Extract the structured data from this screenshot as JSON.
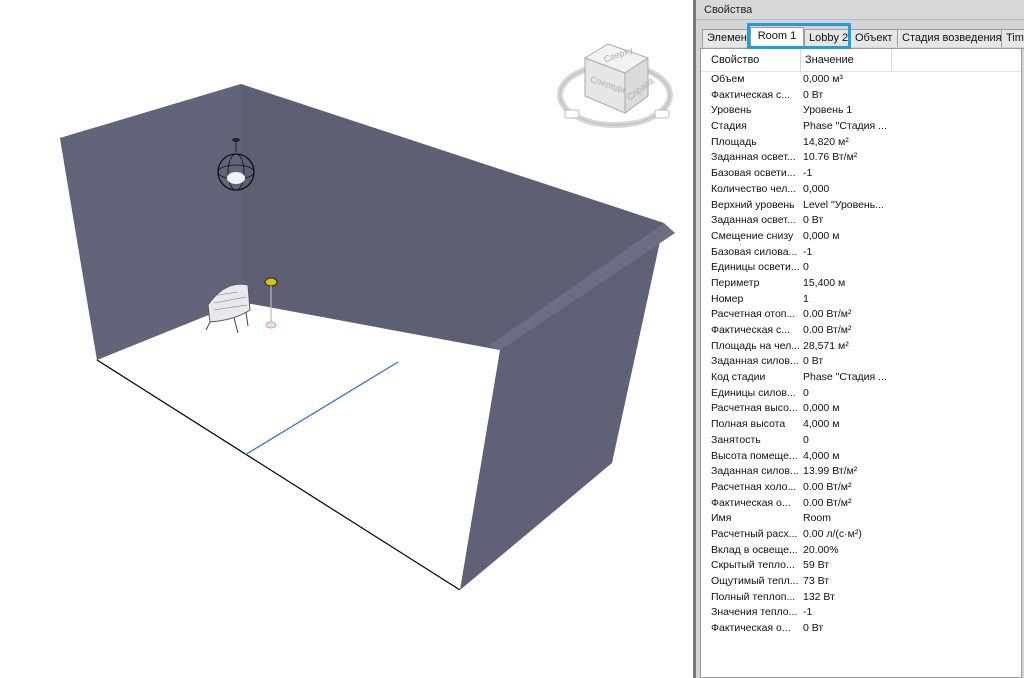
{
  "panel": {
    "title": "Свойства",
    "tabs": [
      {
        "label": "Элемент"
      },
      {
        "label": "Room 1"
      },
      {
        "label": "Lobby 2"
      },
      {
        "label": "Объект"
      },
      {
        "label": "Стадия возведения"
      },
      {
        "label": "Time"
      }
    ],
    "active_tab": "Room 1",
    "columns": {
      "property": "Свойство",
      "value": "Значение"
    },
    "rows": [
      {
        "prop": "Объем",
        "val": "0,000 м³"
      },
      {
        "prop": "Фактическая с...",
        "val": "0 Вт"
      },
      {
        "prop": "Уровень",
        "val": "Уровень 1"
      },
      {
        "prop": "Стадия",
        "val": "Phase \"Стадия ..."
      },
      {
        "prop": "Площадь",
        "val": "14,820 м²"
      },
      {
        "prop": "Заданная освет...",
        "val": "10.76 Вт/м²"
      },
      {
        "prop": "Базовая освети...",
        "val": "-1"
      },
      {
        "prop": "Количество чел...",
        "val": "0,000"
      },
      {
        "prop": "Верхний уровень",
        "val": "Level \"Уровень..."
      },
      {
        "prop": "Заданная освет...",
        "val": "0 Вт"
      },
      {
        "prop": "Смещение снизу",
        "val": "0,000 м"
      },
      {
        "prop": "Базовая силова...",
        "val": "-1"
      },
      {
        "prop": "Единицы освети...",
        "val": "0"
      },
      {
        "prop": "Периметр",
        "val": "15,400 м"
      },
      {
        "prop": "Номер",
        "val": "1"
      },
      {
        "prop": "Расчетная отоп...",
        "val": "0.00 Вт/м²"
      },
      {
        "prop": "Фактическая с...",
        "val": "0.00 Вт/м²"
      },
      {
        "prop": "Площадь на чел...",
        "val": "28,571 м²"
      },
      {
        "prop": "Заданная силов...",
        "val": "0 Вт"
      },
      {
        "prop": "Код стадии",
        "val": "Phase \"Стадия ..."
      },
      {
        "prop": "Единицы силов...",
        "val": "0"
      },
      {
        "prop": "Расчетная высо...",
        "val": "0,000 м"
      },
      {
        "prop": "Полная высота",
        "val": "4,000 м"
      },
      {
        "prop": "Занятость",
        "val": "0"
      },
      {
        "prop": "Высота помеще...",
        "val": "4,000 м"
      },
      {
        "prop": "Заданная силов...",
        "val": "13.99 Вт/м²"
      },
      {
        "prop": "Расчетная холо...",
        "val": "0.00 Вт/м²"
      },
      {
        "prop": "Фактическая о...",
        "val": "0.00 Вт/м²"
      },
      {
        "prop": "Имя",
        "val": "Room"
      },
      {
        "prop": "Расчетный расх...",
        "val": "0.00 л/(с·м²)"
      },
      {
        "prop": "Вклад в освеще...",
        "val": "20.00%"
      },
      {
        "prop": "Скрытый тепло...",
        "val": "59 Вт"
      },
      {
        "prop": "Ощутимый тепл...",
        "val": "73 Вт"
      },
      {
        "prop": "Полный теплоп...",
        "val": "132 Вт"
      },
      {
        "prop": "Значения тепло...",
        "val": "-1"
      },
      {
        "prop": "Фактическая о...",
        "val": "0 Вт"
      }
    ]
  },
  "viewcube": {
    "top_label": "Сверху",
    "left_label": "Спереди",
    "right_label": "Справа"
  },
  "colors": {
    "wall": "#5d5f73",
    "highlight": "#1ea0e0",
    "room_edge_selected": "#3a6fe0",
    "panel_bg": "#d4d4d4"
  }
}
